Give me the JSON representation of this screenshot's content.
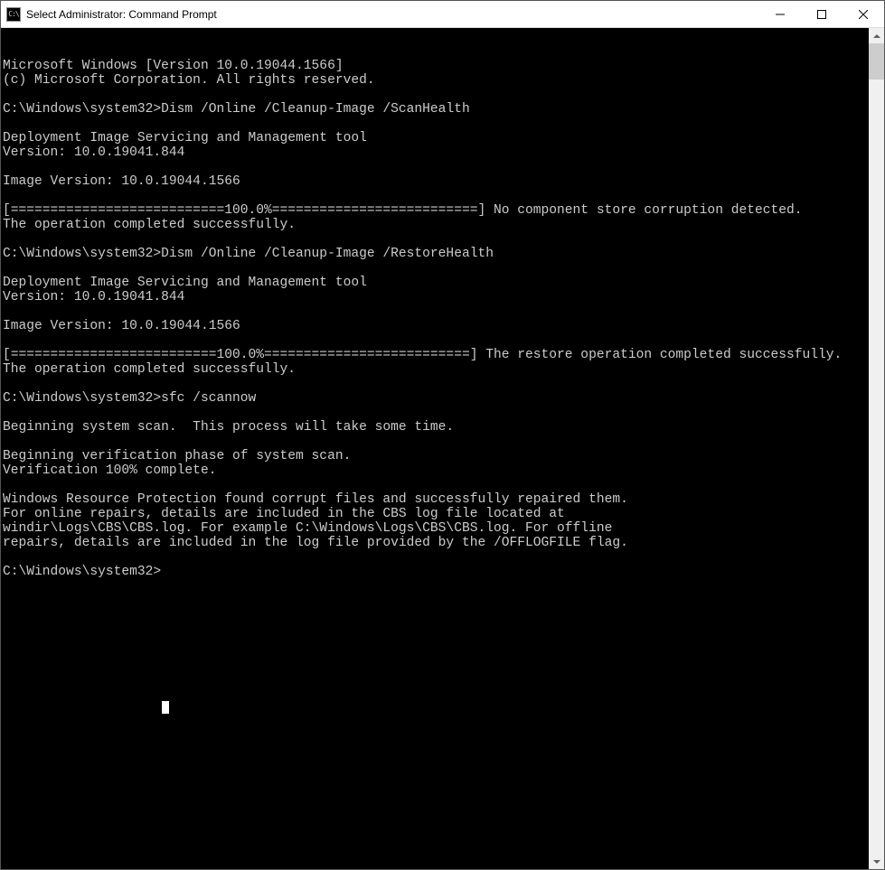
{
  "window": {
    "title": "Select Administrator: Command Prompt",
    "icon_label": "CMD"
  },
  "console": {
    "lines": [
      "Microsoft Windows [Version 10.0.19044.1566]",
      "(c) Microsoft Corporation. All rights reserved.",
      "",
      "C:\\Windows\\system32>Dism /Online /Cleanup-Image /ScanHealth",
      "",
      "Deployment Image Servicing and Management tool",
      "Version: 10.0.19041.844",
      "",
      "Image Version: 10.0.19044.1566",
      "",
      "[===========================100.0%==========================] No component store corruption detected.",
      "The operation completed successfully.",
      "",
      "C:\\Windows\\system32>Dism /Online /Cleanup-Image /RestoreHealth",
      "",
      "Deployment Image Servicing and Management tool",
      "Version: 10.0.19041.844",
      "",
      "Image Version: 10.0.19044.1566",
      "",
      "[==========================100.0%==========================] The restore operation completed successfully.",
      "The operation completed successfully.",
      "",
      "C:\\Windows\\system32>sfc /scannow",
      "",
      "Beginning system scan.  This process will take some time.",
      "",
      "Beginning verification phase of system scan.",
      "Verification 100% complete.",
      "",
      "Windows Resource Protection found corrupt files and successfully repaired them.",
      "For online repairs, details are included in the CBS log file located at",
      "windir\\Logs\\CBS\\CBS.log. For example C:\\Windows\\Logs\\CBS\\CBS.log. For offline",
      "repairs, details are included in the log file provided by the /OFFLOGFILE flag.",
      "",
      "C:\\Windows\\system32>"
    ]
  }
}
